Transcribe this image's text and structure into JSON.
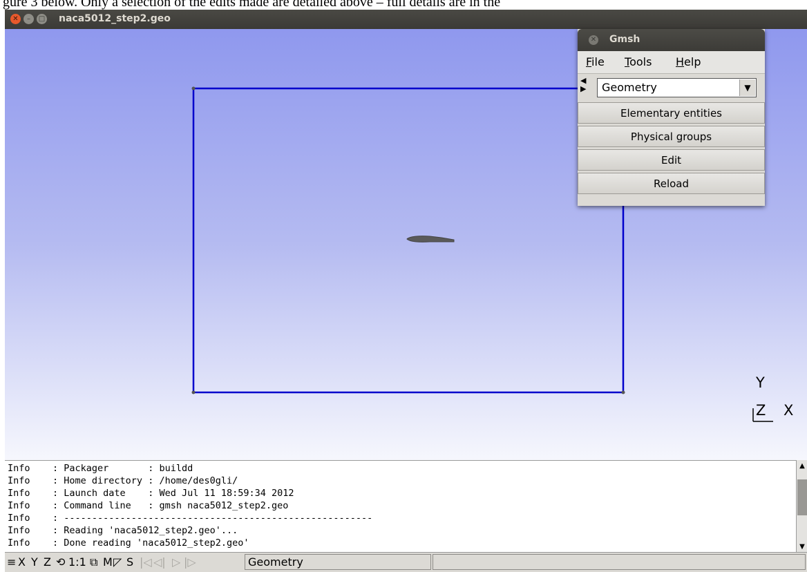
{
  "document_caption": "gure 3 below.  Only a selection of the edits made are detailed above – full details are in the",
  "window": {
    "title": "naca5012_step2.geo"
  },
  "axes": {
    "y": "Y",
    "z": "Z",
    "x": "X"
  },
  "gmsh": {
    "title": "Gmsh",
    "menu": [
      {
        "mnemonic": "F",
        "rest": "ile"
      },
      {
        "mnemonic": "T",
        "rest": "ools"
      },
      {
        "mnemonic": "H",
        "rest": "elp"
      }
    ],
    "module": "Geometry",
    "buttons": [
      "Elementary entities",
      "Physical groups",
      "Edit",
      "Reload"
    ]
  },
  "console": [
    "Info    : Packager       : buildd",
    "Info    : Home directory : /home/des0gli/",
    "Info    : Launch date    : Wed Jul 11 18:59:34 2012",
    "Info    : Command line   : gmsh naca5012_step2.geo",
    "Info    : -------------------------------------------------------",
    "Info    : Reading 'naca5012_step2.geo'...",
    "Info    : Done reading 'naca5012_step2.geo'"
  ],
  "status": {
    "items": [
      "X",
      "Y",
      "Z",
      "1:1",
      "M",
      "S"
    ],
    "message": "Geometry"
  },
  "colors": {
    "geometry_line": "#0000cc",
    "airfoil": "#555555",
    "viewport_top": "#8f98ee",
    "viewport_bottom": "#f6f7fd"
  }
}
